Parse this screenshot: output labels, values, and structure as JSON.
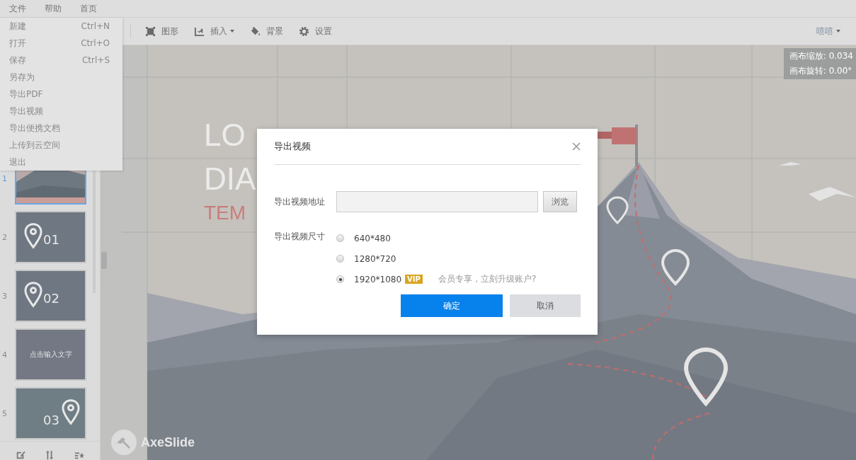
{
  "menubar": [
    {
      "label": "文件"
    },
    {
      "label": "帮助"
    },
    {
      "label": "首页"
    }
  ],
  "file_menu": [
    {
      "label": "新建",
      "shortcut": "Ctrl+N"
    },
    {
      "label": "打开",
      "shortcut": "Ctrl+O"
    },
    {
      "label": "保存",
      "shortcut": "Ctrl+S"
    },
    {
      "label": "另存为"
    },
    {
      "label": "导出PDF"
    },
    {
      "label": "导出视频"
    },
    {
      "label": "导出便携文档"
    },
    {
      "label": "上传到云空间"
    },
    {
      "label": "退出"
    }
  ],
  "toolbar": {
    "items": [
      {
        "label": "图形",
        "has_menu": false
      },
      {
        "label": "插入",
        "has_menu": true
      },
      {
        "label": "背景",
        "has_menu": false
      },
      {
        "label": "设置",
        "has_menu": false
      }
    ],
    "user": {
      "label": "嘻嘻",
      "has_menu": true
    }
  },
  "slides": [
    {
      "number": "1",
      "selected": true,
      "kind": "picture"
    },
    {
      "number": "2",
      "selected": false,
      "kind": "pin",
      "badge": "01"
    },
    {
      "number": "3",
      "selected": false,
      "kind": "pin",
      "badge": "02"
    },
    {
      "number": "4",
      "selected": false,
      "kind": "text",
      "caption": "点击输入文字"
    },
    {
      "number": "5",
      "selected": false,
      "kind": "pin-right",
      "badge": "03"
    }
  ],
  "canvas": {
    "title_lines": [
      "LO",
      "DIA"
    ],
    "subtitle": "TEM",
    "zoom": "画布缩放: 0.034",
    "rotation": "画布旋转: 0.00°",
    "logo": "AxeSlide"
  },
  "dialog": {
    "title": "导出视频",
    "path_label": "导出视频地址",
    "browse": "浏览",
    "size_label": "导出视频尺寸",
    "sizes": [
      {
        "label": "640*480",
        "selected": false
      },
      {
        "label": "1280*720",
        "selected": false
      },
      {
        "label": "1920*1080",
        "selected": true,
        "badge": "VIP",
        "note": "会员专享，立刻升级账户?"
      }
    ],
    "buttons": [
      {
        "label": "确定",
        "kind": "primary"
      },
      {
        "label": "取消",
        "kind": "secondary"
      }
    ]
  }
}
